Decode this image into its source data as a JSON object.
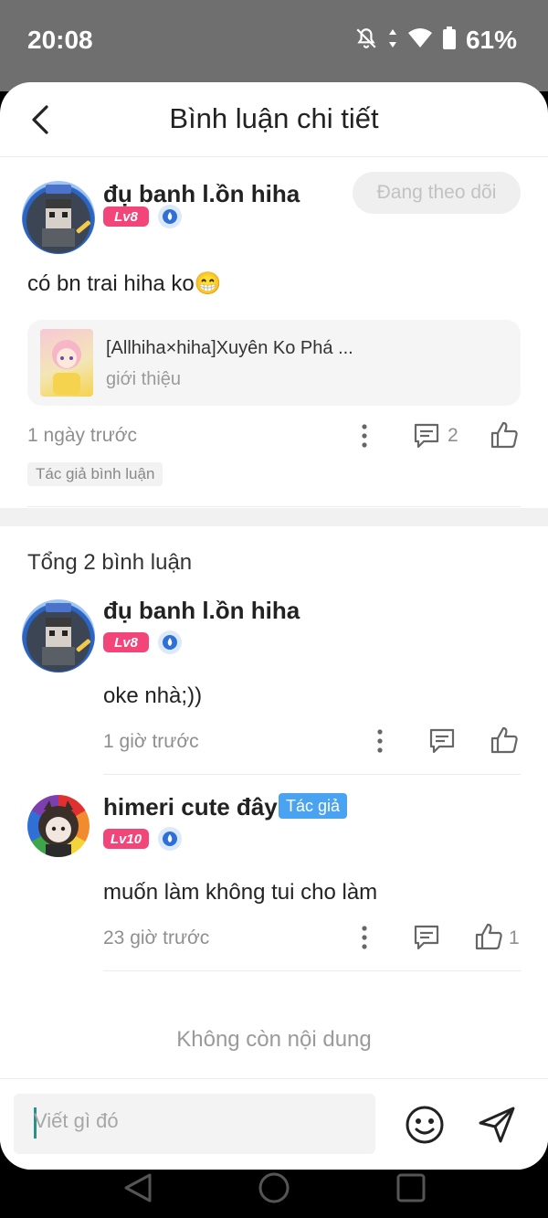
{
  "status_bar": {
    "time": "20:08",
    "battery": "61%"
  },
  "header": {
    "title": "Bình luận chi tiết"
  },
  "main_comment": {
    "username": "đụ banh l.ồn hiha",
    "level": "Lv8",
    "follow_label": "Đang theo dõi",
    "text": "có bn trai hiha ko😁",
    "story": {
      "title": "[Allhiha×hiha]Xuyên Ko Phá ...",
      "subtitle": "giới thiệu"
    },
    "time": "1 ngày trước",
    "reply_count": "2",
    "tag": "Tác giả bình luận"
  },
  "replies_header": "Tổng 2 bình luận",
  "replies": [
    {
      "username": "đụ banh l.ồn hiha",
      "level": "Lv8",
      "text": "oke nhà;))",
      "time": "1 giờ trước",
      "like_count": ""
    },
    {
      "username": "himeri cute đây",
      "author_tag": "Tác giả",
      "level": "Lv10",
      "text": "muốn làm không tui cho làm",
      "time": "23 giờ trước",
      "like_count": "1"
    }
  ],
  "end_text": "Không còn nội dung",
  "input": {
    "placeholder": "Viết gì đó"
  },
  "colors": {
    "level_badge": "#f2457a",
    "author_tag": "#4aa3f0",
    "status_bar": "#6f6f6f"
  }
}
